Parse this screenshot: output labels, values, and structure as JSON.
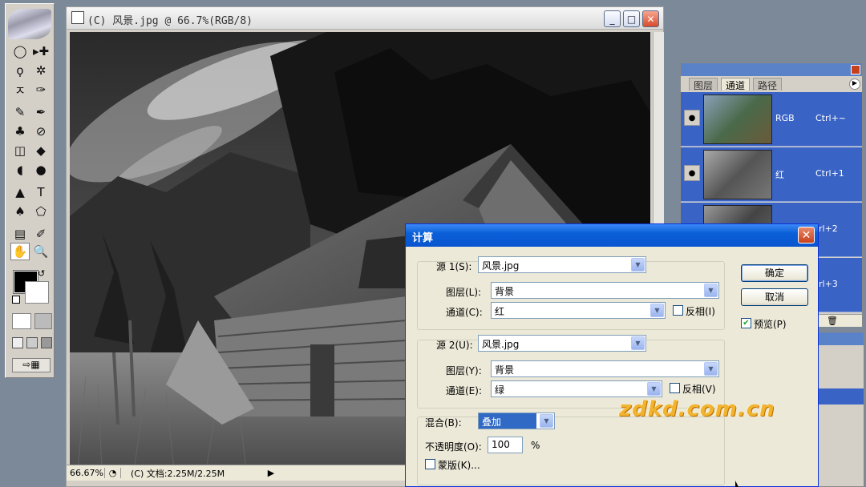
{
  "document": {
    "title": "(C) 风景.jpg @ 66.7%(RGB/8)",
    "zoom": "66.67%",
    "doc_info": "(C) 文档:2.25M/2.25M",
    "window_buttons": {
      "minimize": "_",
      "maximize": "□",
      "close": "✕"
    }
  },
  "toolbox": {
    "tools": [
      "◯",
      "▸✚",
      "ϙ",
      "✲",
      "ㅈ",
      "✑",
      "✎",
      "✒",
      "♣",
      "⊘",
      "◫",
      "◆",
      "◖",
      "●",
      "▲",
      "T",
      "♠",
      "⬠",
      "▤",
      "✐",
      "✋",
      "🔍"
    ],
    "foreground_color": "#000000",
    "background_color": "#ffffff"
  },
  "channels_panel": {
    "tabs": [
      "图层",
      "通道",
      "路径"
    ],
    "active_tab": "通道",
    "rows": [
      {
        "name": "RGB",
        "shortcut": "Ctrl+~"
      },
      {
        "name": "红",
        "shortcut": "Ctrl+1"
      },
      {
        "name": "",
        "shortcut": "rl+2"
      },
      {
        "name": "",
        "shortcut": "rl+3"
      }
    ]
  },
  "dialog": {
    "title": "计算",
    "close": "✕",
    "source1": {
      "label": "源 1(S):",
      "file": "风景.jpg",
      "layer_label": "图层(L):",
      "layer": "背景",
      "channel_label": "通道(C):",
      "channel": "红",
      "invert_label": "反相(I)",
      "invert": false
    },
    "source2": {
      "label": "源 2(U):",
      "file": "风景.jpg",
      "layer_label": "图层(Y):",
      "layer": "背景",
      "channel_label": "通道(E):",
      "channel": "绿",
      "invert_label": "反相(V)",
      "invert": false
    },
    "blend_label": "混合(B):",
    "blend": "叠加",
    "opacity_label": "不透明度(O):",
    "opacity": "100",
    "opacity_unit": "%",
    "mask_label": "蒙版(K)...",
    "mask": false,
    "ok": "确定",
    "cancel": "取消",
    "preview_label": "预览(P)",
    "preview": true
  },
  "watermark": "zdkd.com.cn"
}
